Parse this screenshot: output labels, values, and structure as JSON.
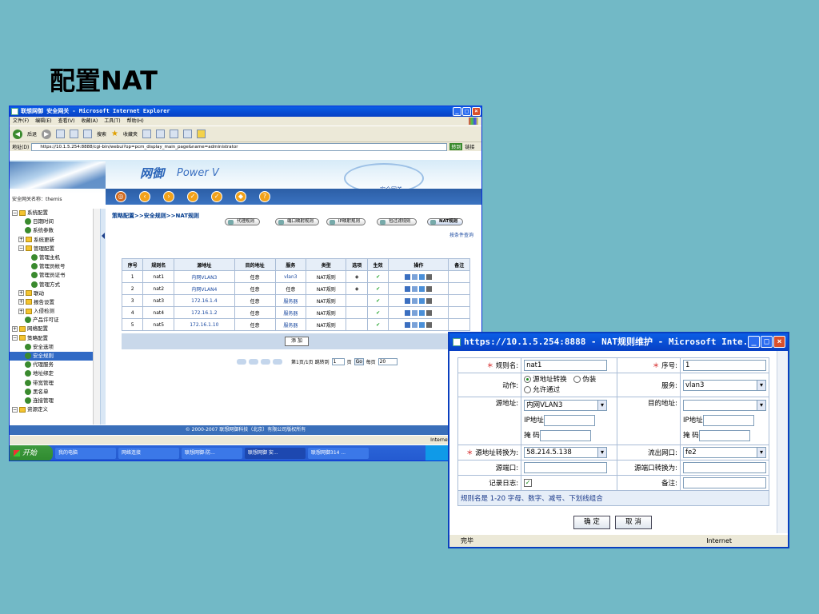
{
  "slide": {
    "title": "配置NAT"
  },
  "browser": {
    "title": "联想网御 安全网关 - Microsoft Internet Explorer",
    "menu": [
      "文件(F)",
      "编辑(E)",
      "查看(V)",
      "收藏(A)",
      "工具(T)",
      "帮助(H)"
    ],
    "toolbar": {
      "back": "后退",
      "search": "搜索",
      "favorites": "收藏夹"
    },
    "address_label": "地址(D)",
    "address": "https://10.1.5.254:8888/cgi-bin/webui?op=pcm_display_main_page&name=administrator",
    "go": "转到",
    "links": "链接"
  },
  "app": {
    "brand": "网御",
    "brand_sub": "Power V",
    "product": "安全网关",
    "gateway_name": "安全网关名称：themis"
  },
  "sidebar": {
    "items": [
      {
        "label": "系统配置",
        "kind": "folder",
        "pm": "−",
        "indent": 0
      },
      {
        "label": "日期时间",
        "kind": "leaf",
        "indent": 2
      },
      {
        "label": "系统参数",
        "kind": "leaf",
        "indent": 2
      },
      {
        "label": "系统更新",
        "kind": "folder",
        "pm": "+",
        "indent": 1
      },
      {
        "label": "管理配置",
        "kind": "folder",
        "pm": "−",
        "indent": 1
      },
      {
        "label": "管理主机",
        "kind": "leaf",
        "indent": 3
      },
      {
        "label": "管理员帐号",
        "kind": "leaf",
        "indent": 3
      },
      {
        "label": "管理员证书",
        "kind": "leaf",
        "indent": 3
      },
      {
        "label": "管理方式",
        "kind": "leaf",
        "indent": 3
      },
      {
        "label": "联动",
        "kind": "folder",
        "pm": "+",
        "indent": 1
      },
      {
        "label": "报告设置",
        "kind": "folder",
        "pm": "+",
        "indent": 1
      },
      {
        "label": "入侵检测",
        "kind": "folder",
        "pm": "+",
        "indent": 1
      },
      {
        "label": "产品许可证",
        "kind": "leaf",
        "indent": 2
      },
      {
        "label": "网络配置",
        "kind": "folder",
        "pm": "+",
        "indent": 0
      },
      {
        "label": "策略配置",
        "kind": "folder",
        "pm": "−",
        "indent": 0
      },
      {
        "label": "安全选项",
        "kind": "leaf",
        "indent": 2
      },
      {
        "label": "安全规则",
        "kind": "leaf",
        "indent": 2,
        "selected": true
      },
      {
        "label": "代理服务",
        "kind": "leaf",
        "indent": 2
      },
      {
        "label": "地址绑定",
        "kind": "leaf",
        "indent": 2
      },
      {
        "label": "带宽管理",
        "kind": "leaf",
        "indent": 2
      },
      {
        "label": "黑名单",
        "kind": "leaf",
        "indent": 2
      },
      {
        "label": "连接管理",
        "kind": "leaf",
        "indent": 2
      },
      {
        "label": "资源定义",
        "kind": "folder",
        "pm": "−",
        "indent": 0
      }
    ]
  },
  "content": {
    "breadcrumb": "策略配置>>安全规则>>NAT规则",
    "tabs": [
      "代理规则",
      "端口映射规则",
      "IP映射规则",
      "包过滤规则",
      "NAT规则"
    ],
    "active_tab": 4,
    "by_query": "按条件查询",
    "table": {
      "headers": [
        "序号",
        "规则名",
        "源地址",
        "目的地址",
        "服务",
        "类型",
        "选项",
        "生效",
        "操作",
        "备注"
      ],
      "rows": [
        {
          "no": "1",
          "name": "nat1",
          "src": "内网VLAN3",
          "dst": "任意",
          "svc": "vlan3",
          "type": "NAT规则",
          "opt": "◈",
          "on": "✔",
          "note": ""
        },
        {
          "no": "2",
          "name": "nat2",
          "src": "内网VLAN4",
          "dst": "任意",
          "svc": "任意",
          "type": "NAT规则",
          "opt": "◈",
          "on": "✔",
          "note": ""
        },
        {
          "no": "3",
          "name": "nat3",
          "src": "172.16.1.4",
          "dst": "任意",
          "svc": "服务器",
          "type": "NAT规则",
          "opt": "",
          "on": "✔",
          "note": ""
        },
        {
          "no": "4",
          "name": "nat4",
          "src": "172.16.1.2",
          "dst": "任意",
          "svc": "服务器",
          "type": "NAT规则",
          "opt": "",
          "on": "✔",
          "note": ""
        },
        {
          "no": "5",
          "name": "nat5",
          "src": "172.16.1.10",
          "dst": "任意",
          "svc": "服务器",
          "type": "NAT规则",
          "opt": "",
          "on": "✔",
          "note": ""
        }
      ]
    },
    "add_label": "添 加",
    "pager": {
      "info": "第1页/1页 跳转到",
      "page": "1",
      "page_unit": "页",
      "go": "Go",
      "per_page_label": "每页",
      "per_page": "20"
    }
  },
  "footer": {
    "copyright": "© 2000-2007 联想网御科技（北京）有限公司版权所有"
  },
  "status": {
    "zone": "Internet"
  },
  "taskbar": {
    "start": "开始",
    "tasks": [
      "我的电脑",
      "网络连接",
      "联想网御-防...",
      "联想网御 安...",
      "联想网御314 ..."
    ],
    "active_task": 3
  },
  "popup": {
    "title": "https://10.1.5.254:8888 - NAT规则维护 - Microsoft Inte...",
    "fields": {
      "rule_name_label": "规则名:",
      "rule_name": "nat1",
      "seq_label": "序号:",
      "seq": "1",
      "action_label": "动作:",
      "action_opts": [
        "源地址转换",
        "伪装",
        "允许通过"
      ],
      "service_label": "服务:",
      "service": "vlan3",
      "src_label": "源地址:",
      "src": "内网VLAN3",
      "dst_label": "目的地址:",
      "dst": "",
      "ip_label": "IP地址",
      "mask_label": "掩  码",
      "src_nat_label": "源地址转换为:",
      "src_nat": "58.214.5.138",
      "out_if_label": "流出网口:",
      "out_if": "fe2",
      "src_port_label": "源端口:",
      "src_port": "",
      "src_port_nat_label": "源端口转换为:",
      "src_port_nat": "",
      "log_label": "记录日志:",
      "note_label": "备注:",
      "note": ""
    },
    "hint": "规则名是 1-20 字母、数字、减号、下划线组合",
    "ok": "确 定",
    "cancel": "取 消",
    "status": "完毕",
    "zone": "Internet"
  }
}
